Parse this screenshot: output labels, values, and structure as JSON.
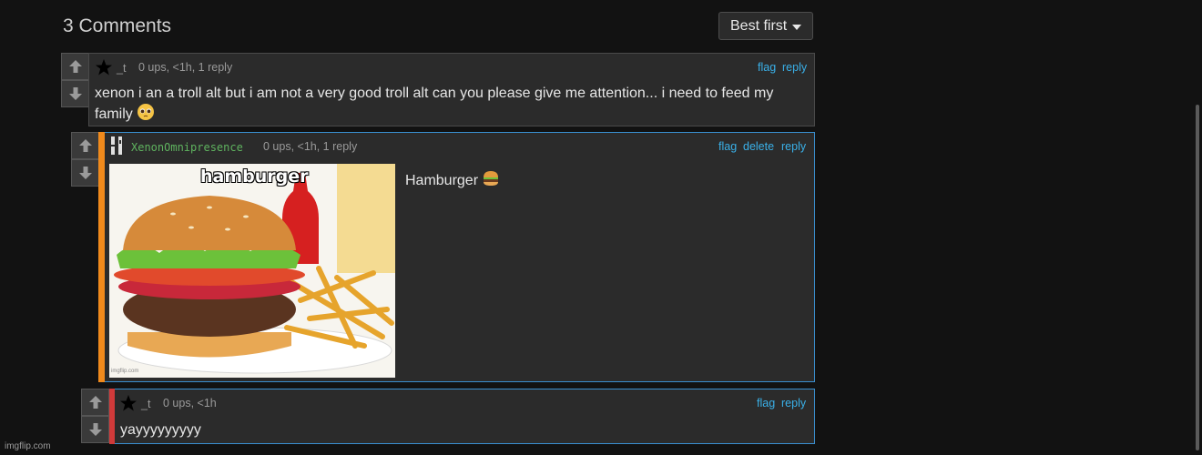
{
  "header": {
    "title": "3 Comments",
    "sort_label": "Best first"
  },
  "comments": [
    {
      "author": "_t",
      "meta": "0 ups, <1h, 1 reply",
      "actions": [
        "flag",
        "reply"
      ],
      "text": "xenon i an a troll alt but i am not a very good troll alt can you please give me attention... i need to feed my family"
    },
    {
      "author": "XenonOmnipresence",
      "meta": "0 ups, <1h, 1 reply",
      "actions": [
        "flag",
        "delete",
        "reply"
      ],
      "text": "Hamburger",
      "image_caption": "hamburger",
      "image_watermark": "imgflip.com"
    },
    {
      "author": "_t",
      "meta": "0 ups, <1h",
      "actions": [
        "flag",
        "reply"
      ],
      "text": "yayyyyyyyyy"
    }
  ],
  "footer": {
    "watermark": "imgflip.com"
  },
  "colors": {
    "link": "#3ab0e8",
    "author_green": "#5fb35f",
    "reply_orange": "#f08a1c",
    "reply_red": "#d03a3a",
    "highlight_border": "#3a8fd0"
  }
}
